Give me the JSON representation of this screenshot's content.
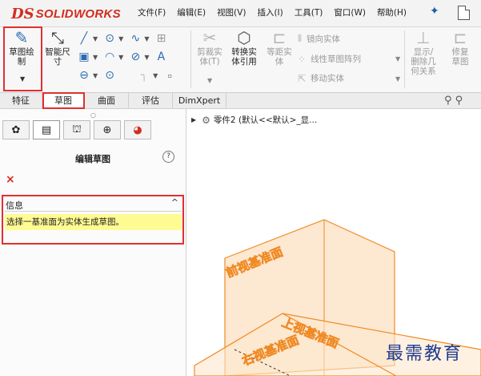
{
  "app": {
    "logo_prefix": "DS",
    "logo_name": "SOLIDWORKS"
  },
  "menu": [
    "文件(F)",
    "编辑(E)",
    "视图(V)",
    "插入(I)",
    "工具(T)",
    "窗口(W)",
    "帮助(H)"
  ],
  "ribbon": {
    "sketch_label": "草图绘制",
    "smart_dim_label": "智能尺寸",
    "trim_label": "剪裁实体(T)",
    "convert_label": "转换实体引用",
    "offset_label": "等距实体",
    "mirror_label": "镜向实体",
    "pattern_label": "线性草图阵列",
    "move_label": "移动实体",
    "show_rel_label": "显示/删除几何关系",
    "repair_label": "修复草图"
  },
  "tabs": [
    "特征",
    "草图",
    "曲面",
    "评估",
    "DimXpert"
  ],
  "property_manager": {
    "title": "编辑草图",
    "help": "?",
    "close": "×",
    "info_title": "信息",
    "info_message": "选择一基准面为实体生成草图。"
  },
  "tree": {
    "label": "零件2  (默认<<默认>_显..."
  },
  "planes": {
    "front": "前视基准面",
    "top": "上视基准面",
    "right": "右视基准面"
  },
  "watermark": "最需教育",
  "colors": {
    "plane": "#f08a24",
    "highlight": "#e03030",
    "info_bg": "#fffb93",
    "brand": "#d52b1e"
  }
}
